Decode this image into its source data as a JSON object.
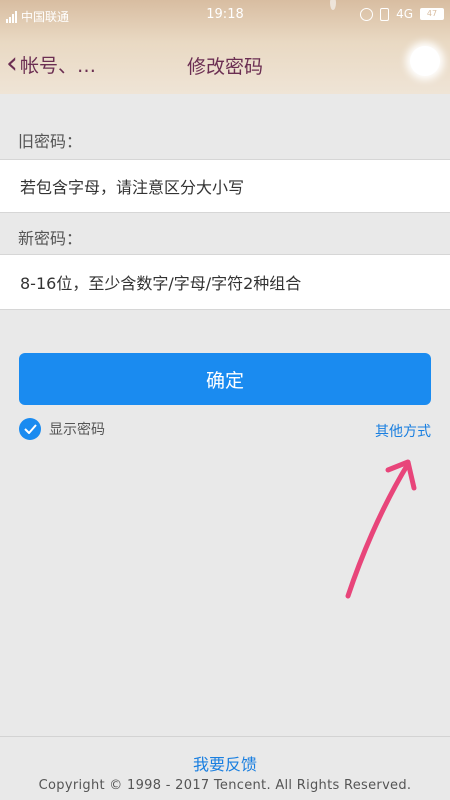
{
  "status_bar": {
    "carrier": "中国联通",
    "time": "19:18",
    "network": "4G",
    "battery": "47"
  },
  "header": {
    "back_label": "帐号、…",
    "title": "修改密码"
  },
  "form": {
    "old_password_label": "旧密码：",
    "old_password_placeholder": "若包含字母，请注意区分大小写",
    "old_password_value": "",
    "new_password_label": "新密码：",
    "new_password_placeholder": "8-16位，至少含数字/字母/字符2种组合",
    "new_password_value": ""
  },
  "actions": {
    "confirm_label": "确定",
    "show_password_label": "显示密码",
    "show_password_checked": true,
    "other_methods_label": "其他方式"
  },
  "footer": {
    "feedback_label": "我要反馈",
    "copyright": "Copyright © 1998 - 2017 Tencent. All Rights Reserved."
  },
  "colors": {
    "accent": "#1a8bf0",
    "link": "#1a7fe0",
    "header_text": "#6b2e52",
    "annotation_arrow": "#e8457a"
  }
}
